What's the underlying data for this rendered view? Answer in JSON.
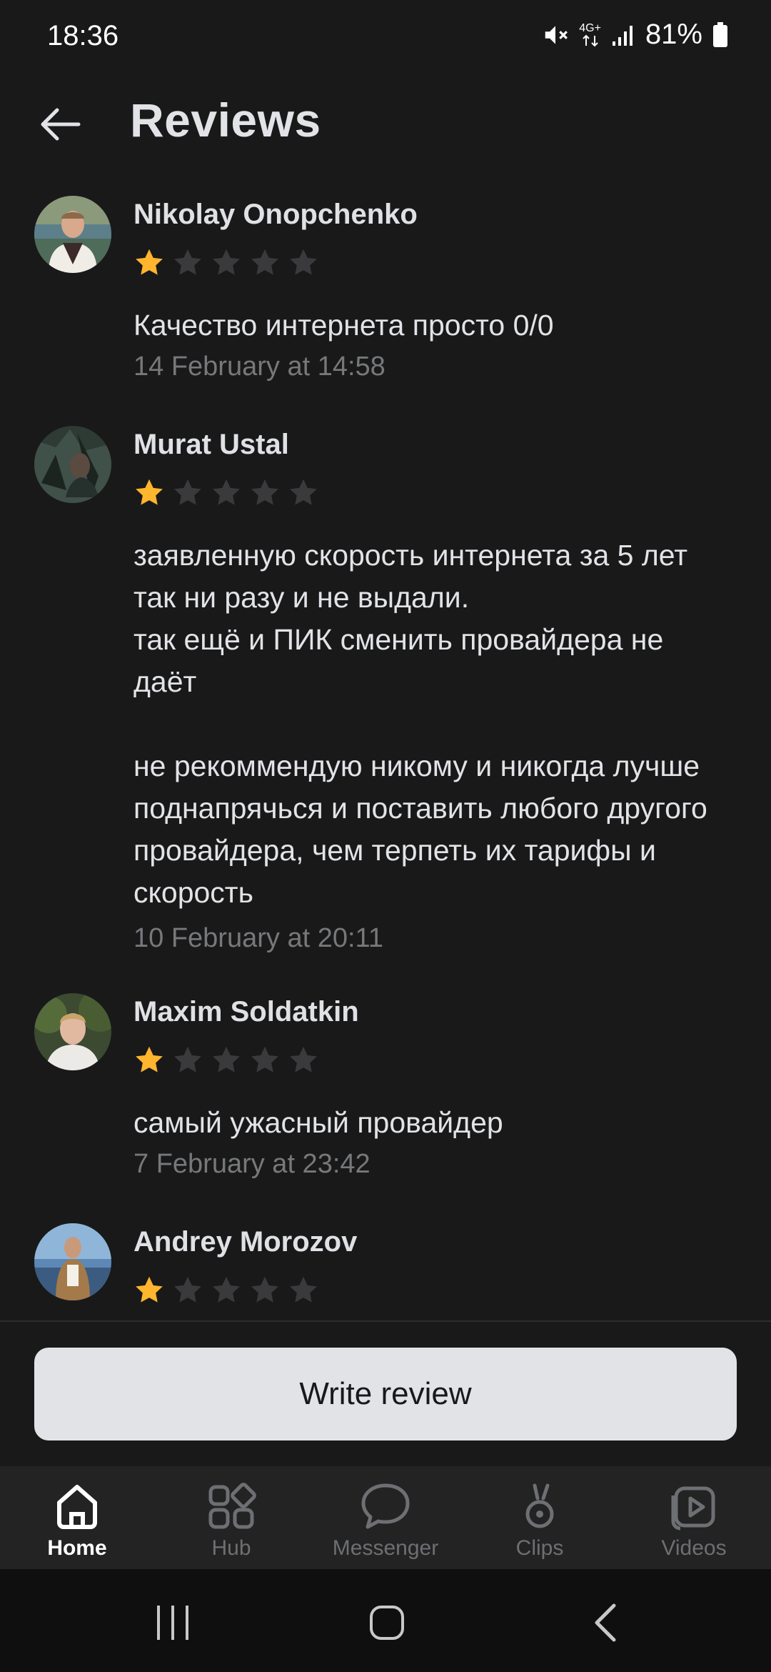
{
  "status": {
    "time": "18:36",
    "network": "4G+",
    "battery": "81%",
    "icons": [
      "mute-icon",
      "network-4g-icon",
      "signal-icon",
      "battery-icon"
    ]
  },
  "header": {
    "title": "Reviews",
    "back_icon": "arrow-left-icon"
  },
  "reviews": [
    {
      "name": "Nikolay Onopchenko",
      "rating": 1,
      "max_rating": 5,
      "text": "Качество интернета просто 0/0",
      "date": "14 February at 14:58"
    },
    {
      "name": "Murat Ustal",
      "rating": 1,
      "max_rating": 5,
      "text": "заявленную скорость интернета за 5 лет так ни разу и не выдали.\nтак ещё и ПИК сменить провайдера не даёт\n\nне рекоммендую никому и никогда лучше поднапрячься и поставить любого другого провайдера, чем терпеть их тарифы и скорость",
      "date": "10 February at 20:11"
    },
    {
      "name": "Maxim Soldatkin",
      "rating": 1,
      "max_rating": 5,
      "text": "самый ужасный провайдер",
      "date": "7 February at 23:42"
    },
    {
      "name": "Andrey Morozov",
      "rating": 1,
      "max_rating": 5,
      "text": "",
      "date": ""
    }
  ],
  "write_button": {
    "label": "Write review"
  },
  "tabs": [
    {
      "label": "Home",
      "icon": "home-icon",
      "active": true
    },
    {
      "label": "Hub",
      "icon": "hub-icon",
      "active": false
    },
    {
      "label": "Messenger",
      "icon": "messenger-icon",
      "active": false
    },
    {
      "label": "Clips",
      "icon": "clips-icon",
      "active": false
    },
    {
      "label": "Videos",
      "icon": "videos-icon",
      "active": false
    }
  ],
  "colors": {
    "background": "#19191a",
    "star_filled": "#ffb52e",
    "star_empty": "#3a3a3c",
    "button_bg": "#e1e3e6",
    "text_secondary": "#76787a"
  }
}
